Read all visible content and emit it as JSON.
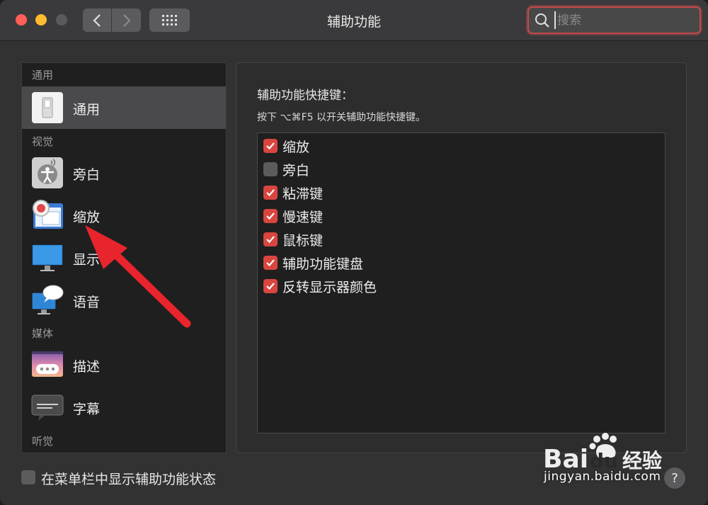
{
  "window": {
    "title": "辅助功能"
  },
  "search": {
    "placeholder": "搜索"
  },
  "sidebar": {
    "sections": [
      {
        "label": "通用"
      },
      {
        "label": "视觉"
      },
      {
        "label": "媒体"
      },
      {
        "label": "听觉"
      }
    ],
    "items": [
      {
        "label": "通用",
        "icon": "switch-icon",
        "selected": true
      },
      {
        "label": "旁白",
        "icon": "voiceover-icon"
      },
      {
        "label": "缩放",
        "icon": "zoom-icon"
      },
      {
        "label": "显示",
        "icon": "display-icon"
      },
      {
        "label": "语音",
        "icon": "speech-icon"
      },
      {
        "label": "描述",
        "icon": "descriptions-icon"
      },
      {
        "label": "字幕",
        "icon": "captions-icon"
      }
    ]
  },
  "main": {
    "title": "辅助功能快捷键：",
    "description": "按下 ⌥⌘F5 以开关辅助功能快捷键。",
    "options": [
      {
        "label": "缩放",
        "checked": true
      },
      {
        "label": "旁白",
        "checked": false
      },
      {
        "label": "粘滞键",
        "checked": true
      },
      {
        "label": "慢速键",
        "checked": true
      },
      {
        "label": "鼠标键",
        "checked": true
      },
      {
        "label": "辅助功能键盘",
        "checked": true
      },
      {
        "label": "反转显示器颜色",
        "checked": true
      }
    ]
  },
  "footer": {
    "menubar_label": "在菜单栏中显示辅助功能状态",
    "menubar_checked": false,
    "help": "?"
  },
  "watermark": {
    "text": "jingyan.baidu.com",
    "brand": "Bai du 经验"
  },
  "colors": {
    "accent": "#d9453f",
    "annotation_arrow": "#e8242c"
  }
}
